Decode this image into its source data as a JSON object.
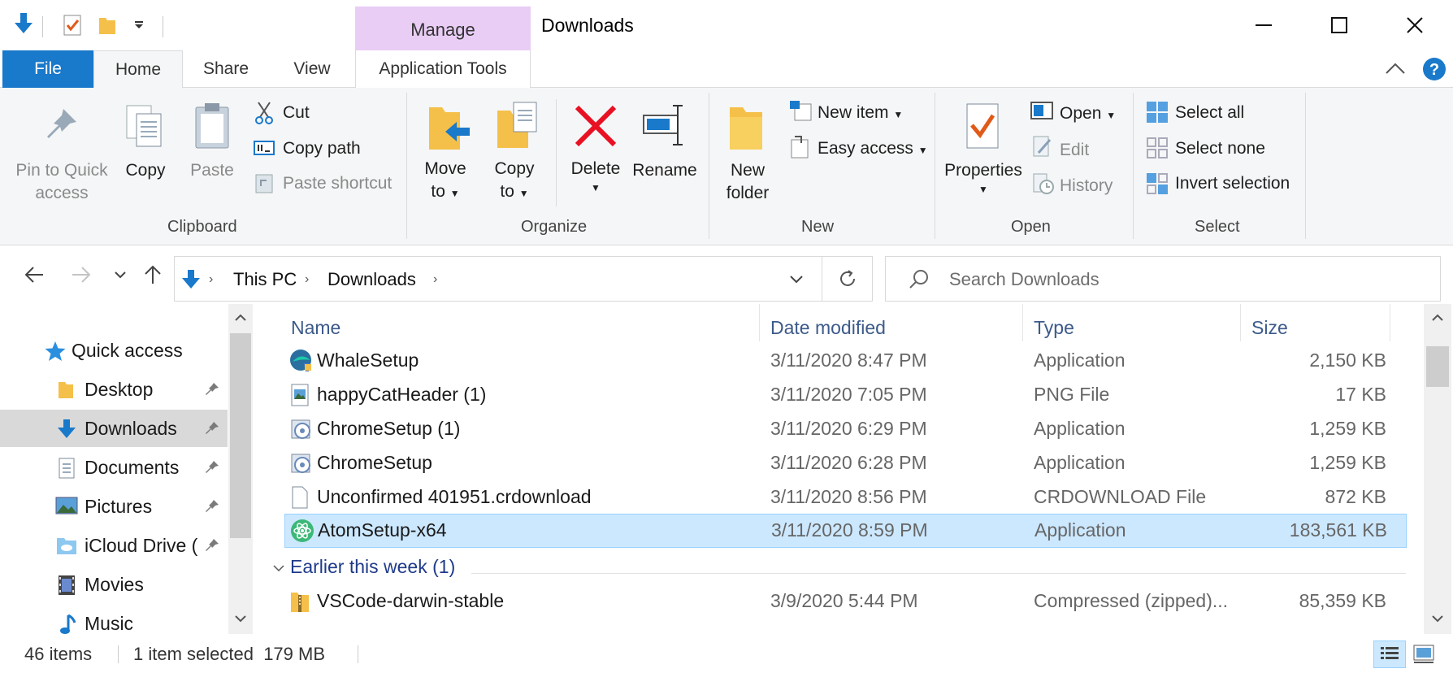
{
  "window": {
    "title": "Downloads",
    "manage_label": "Manage"
  },
  "tabs": {
    "file": "File",
    "home": "Home",
    "share": "Share",
    "view": "View",
    "application_tools": "Application Tools"
  },
  "ribbon": {
    "clipboard": {
      "pin_line1": "Pin to Quick",
      "pin_line2": "access",
      "copy": "Copy",
      "paste": "Paste",
      "cut": "Cut",
      "copy_path": "Copy path",
      "paste_shortcut": "Paste shortcut",
      "group": "Clipboard"
    },
    "organize": {
      "move_line1": "Move",
      "move_line2": "to",
      "copy_line1": "Copy",
      "copy_line2": "to",
      "delete": "Delete",
      "rename": "Rename",
      "group": "Organize"
    },
    "new": {
      "new_folder_line1": "New",
      "new_folder_line2": "folder",
      "new_item": "New item",
      "easy_access": "Easy access",
      "group": "New"
    },
    "open": {
      "properties": "Properties",
      "open": "Open",
      "edit": "Edit",
      "history": "History",
      "group": "Open"
    },
    "select": {
      "select_all": "Select all",
      "select_none": "Select none",
      "invert_selection": "Invert selection",
      "group": "Select"
    }
  },
  "address": {
    "crumbs": [
      "This PC",
      "Downloads"
    ],
    "search_placeholder": "Search Downloads"
  },
  "nav_pane": {
    "items": [
      {
        "label": "Quick access",
        "icon": "star-icon",
        "pinned": false
      },
      {
        "label": "Desktop",
        "icon": "folder-icon",
        "pinned": true
      },
      {
        "label": "Downloads",
        "icon": "download-arrow-icon",
        "pinned": true,
        "selected": true
      },
      {
        "label": "Documents",
        "icon": "documents-icon",
        "pinned": true
      },
      {
        "label": "Pictures",
        "icon": "pictures-icon",
        "pinned": true
      },
      {
        "label": "iCloud Drive (",
        "icon": "cloud-folder-icon",
        "pinned": true
      },
      {
        "label": "Movies",
        "icon": "movies-icon",
        "pinned": false
      },
      {
        "label": "Music",
        "icon": "music-note-icon",
        "pinned": false
      }
    ]
  },
  "file_list": {
    "columns": [
      "Name",
      "Date modified",
      "Type",
      "Size"
    ],
    "rows": [
      {
        "name": "WhaleSetup",
        "date": "3/11/2020 8:47 PM",
        "type": "Application",
        "size": "2,150 KB",
        "icon": "whale-app-icon"
      },
      {
        "name": "happyCatHeader (1)",
        "date": "3/11/2020 7:05 PM",
        "type": "PNG File",
        "size": "17 KB",
        "icon": "image-file-icon"
      },
      {
        "name": "ChromeSetup (1)",
        "date": "3/11/2020 6:29 PM",
        "type": "Application",
        "size": "1,259 KB",
        "icon": "installer-icon"
      },
      {
        "name": "ChromeSetup",
        "date": "3/11/2020 6:28 PM",
        "type": "Application",
        "size": "1,259 KB",
        "icon": "installer-icon"
      },
      {
        "name": "Unconfirmed 401951.crdownload",
        "date": "3/11/2020 8:56 PM",
        "type": "CRDOWNLOAD File",
        "size": "872 KB",
        "icon": "blank-file-icon"
      },
      {
        "name": "AtomSetup-x64",
        "date": "3/11/2020 8:59 PM",
        "type": "Application",
        "size": "183,561 KB",
        "icon": "atom-app-icon",
        "selected": true
      }
    ],
    "group_header": "Earlier this week (1)",
    "group_rows": [
      {
        "name": "VSCode-darwin-stable",
        "date": "3/9/2020 5:44 PM",
        "type": "Compressed (zipped)...",
        "size": "85,359 KB",
        "icon": "zip-folder-icon"
      }
    ]
  },
  "status": {
    "items": "46 items",
    "selection": "1 item selected  179 MB"
  },
  "colors": {
    "file_tab": "#1979ca",
    "manage_tab": "#e9cdf5",
    "selection_fill": "#cce8ff",
    "selection_border": "#99d1ff",
    "delete_red": "#e81123"
  }
}
